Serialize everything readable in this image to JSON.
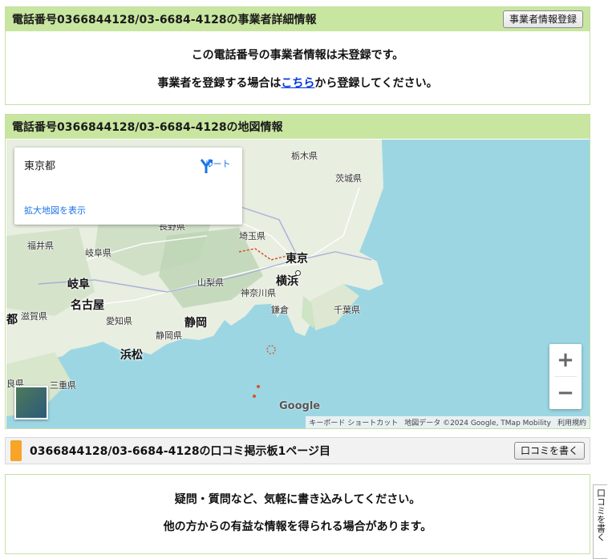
{
  "business": {
    "title": "電話番号0366844128/03-6684-4128の事業者詳細情報",
    "register_button": "事業者情報登録",
    "line1": "この電話番号の事業者情報は未登録です。",
    "line2_prefix": "事業者を登録する場合は",
    "line2_link": "こちら",
    "line2_suffix": "から登録してください。"
  },
  "map_section": {
    "title": "電話番号0366844128/03-6684-4128の地図情報",
    "info_place": "東京都",
    "route_label": "ルート",
    "larger_map": "拡大地図を表示",
    "zoom_in": "+",
    "zoom_out": "−",
    "google_logo": "Google",
    "attribution": {
      "shortcuts": "キーボード ショートカット",
      "data": "地図データ ©2024 Google, TMap Mobility",
      "terms": "利用規約"
    },
    "labels": {
      "tochigi": "栃木県",
      "ibaraki": "茨城県",
      "nagano": "長野県",
      "fukui": "福井県",
      "gifu_pref": "岐阜県",
      "saitama": "埼玉県",
      "tokyo": "東京",
      "yamanashi": "山梨県",
      "yokohama": "横浜",
      "kanagawa": "神奈川県",
      "kamakura": "鎌倉",
      "chiba": "千葉県",
      "gifu_city": "岐阜",
      "nagoya": "名古屋",
      "shiga": "滋賀県",
      "aichi": "愛知県",
      "shizuoka_pref": "静岡県",
      "shizuoka_city": "静岡",
      "hamamatsu": "浜松",
      "miyako": "都",
      "mie": "三重県",
      "nara": "良県"
    }
  },
  "board": {
    "title": "0366844128/03-6684-4128の口コミ掲示板1ページ目",
    "write_button": "口コミを書く",
    "line1": "疑問・質問など、気軽に書き込みしてください。",
    "line2": "他の方からの有益な情報を得られる場合があります。"
  },
  "side_tab": "口コミを書く",
  "colors": {
    "header_green": "#c8e6a0",
    "accent_orange": "#f7a428",
    "link_blue": "#0033dd",
    "sea": "#9cd6e3"
  }
}
